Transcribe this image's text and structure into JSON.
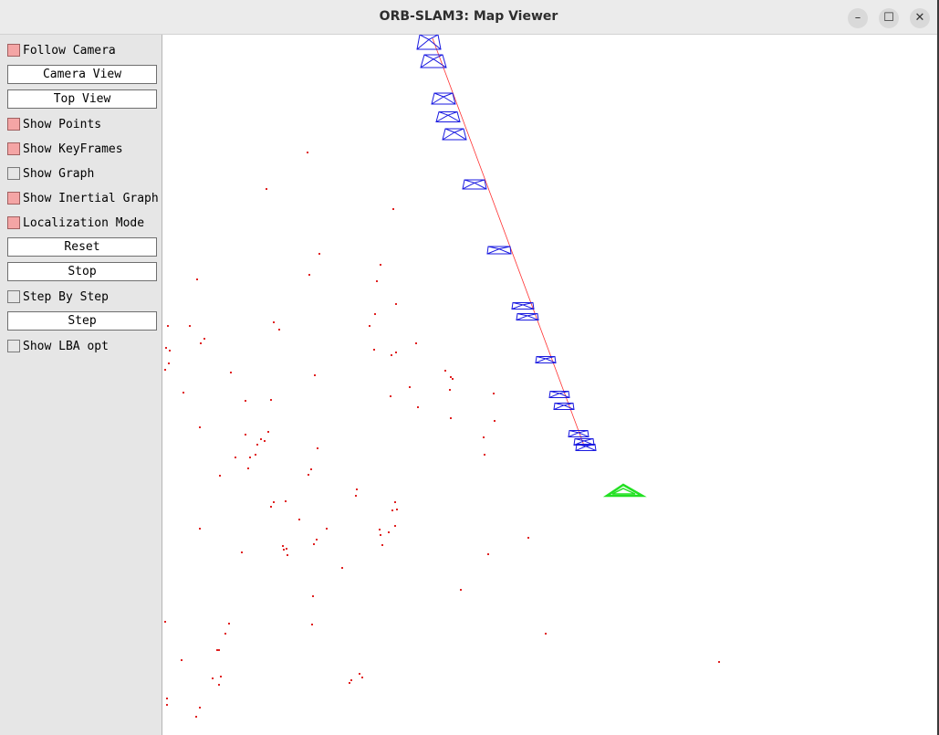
{
  "window": {
    "title": "ORB-SLAM3: Map Viewer",
    "controls": {
      "minimize": "–",
      "maximize": "☐",
      "close": "✕"
    }
  },
  "panel": {
    "follow_camera": {
      "label": "Follow Camera",
      "checked": true
    },
    "camera_view": {
      "label": "Camera View"
    },
    "top_view": {
      "label": "Top View"
    },
    "show_points": {
      "label": "Show Points",
      "checked": true
    },
    "show_keyframes": {
      "label": "Show KeyFrames",
      "checked": true
    },
    "show_graph": {
      "label": "Show Graph",
      "checked": false
    },
    "show_inertial_graph": {
      "label": "Show Inertial Graph",
      "checked": true
    },
    "localization_mode": {
      "label": "Localization Mode",
      "checked": true
    },
    "reset": {
      "label": "Reset"
    },
    "stop": {
      "label": "Stop"
    },
    "step_by_step": {
      "label": "Step By Step",
      "checked": false
    },
    "step": {
      "label": "Step"
    },
    "show_lba_opt": {
      "label": "Show LBA opt",
      "checked": false
    }
  },
  "colors": {
    "checked": "#f4a5a5",
    "map_points": "#e02020",
    "keyframes": "#1a1ae0",
    "trajectory": "#ff3030",
    "current_camera": "#22e022"
  }
}
